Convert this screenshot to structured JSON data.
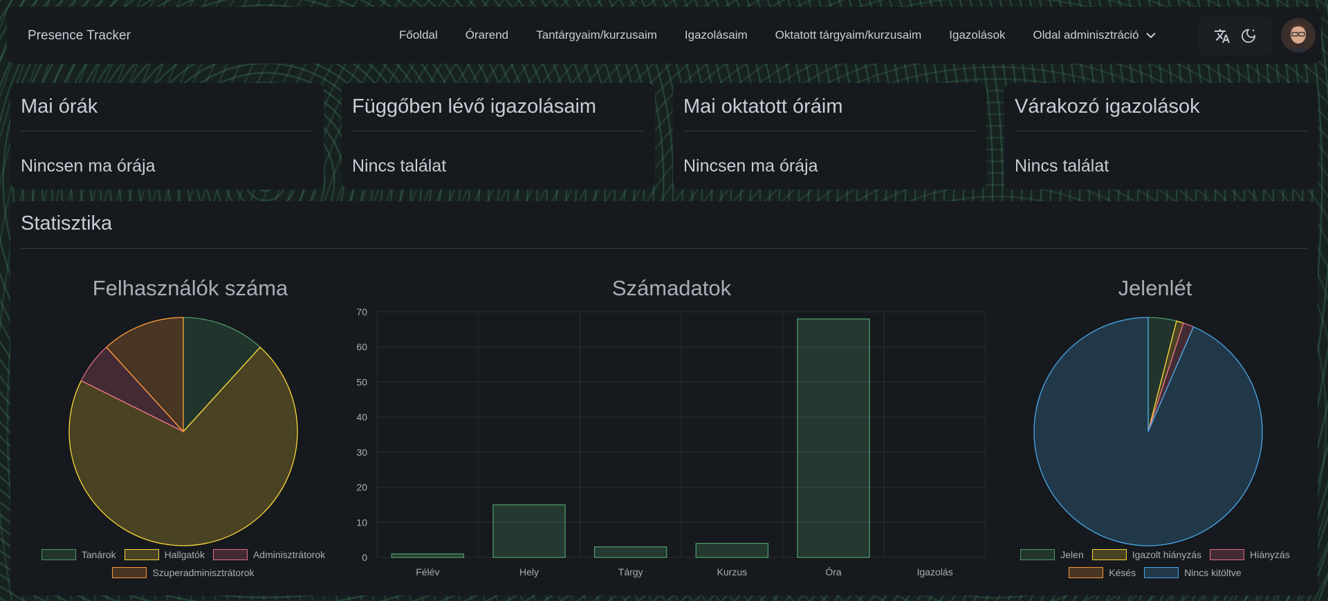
{
  "navbar": {
    "brand": "Presence Tracker",
    "links": [
      "Főoldal",
      "Órarend",
      "Tantárgyaim/kurzusaim",
      "Igazolásaim",
      "Oktatott tárgyaim/kurzusaim",
      "Igazolások"
    ],
    "admin_dropdown": "Oldal adminisztráció",
    "icons": [
      "translate-icon",
      "dark-mode-icon"
    ]
  },
  "cards": [
    {
      "title": "Mai órák",
      "empty": "Nincsen ma órája"
    },
    {
      "title": "Függőben lévő igazolásaim",
      "empty": "Nincs találat"
    },
    {
      "title": "Mai oktatott óráim",
      "empty": "Nincsen ma órája"
    },
    {
      "title": "Várakozó igazolások",
      "empty": "Nincs találat"
    }
  ],
  "stats": {
    "title": "Statisztika"
  },
  "colors": {
    "green": "#4e9a6a",
    "yellow": "#ffd83a",
    "pink": "#e06c88",
    "orange": "#ff9a3a",
    "blue": "#4aa8e8"
  },
  "chart_data": [
    {
      "type": "pie",
      "title": "Felhasználók száma",
      "labels": [
        "Tanárok",
        "Hallgatók",
        "Adminisztrátorok",
        "Szuperadminisztrátorok"
      ],
      "values": [
        2,
        12,
        1,
        2
      ],
      "colors": [
        "#4e9a6a",
        "#ffd83a",
        "#e06c88",
        "#ff9a3a"
      ],
      "legend": "bottom"
    },
    {
      "type": "bar",
      "title": "Számadatok",
      "categories": [
        "Félév",
        "Hely",
        "Tárgy",
        "Kurzus",
        "Óra",
        "Igazolás"
      ],
      "values": [
        1,
        15,
        3,
        4,
        68,
        0
      ],
      "ylim": [
        0,
        70
      ],
      "yticks": [
        0,
        10,
        20,
        30,
        40,
        50,
        60,
        70
      ],
      "grid": true
    },
    {
      "type": "pie",
      "title": "Jelenlét",
      "labels": [
        "Jelen",
        "Igazolt hiányzás",
        "Hiányzás",
        "Késés",
        "Nincs kitöltve"
      ],
      "values": [
        4,
        1,
        1.5,
        0,
        93.5
      ],
      "colors": [
        "#4e9a6a",
        "#ffd83a",
        "#e06c88",
        "#ff9a3a",
        "#4aa8e8"
      ],
      "legend": "bottom"
    }
  ]
}
